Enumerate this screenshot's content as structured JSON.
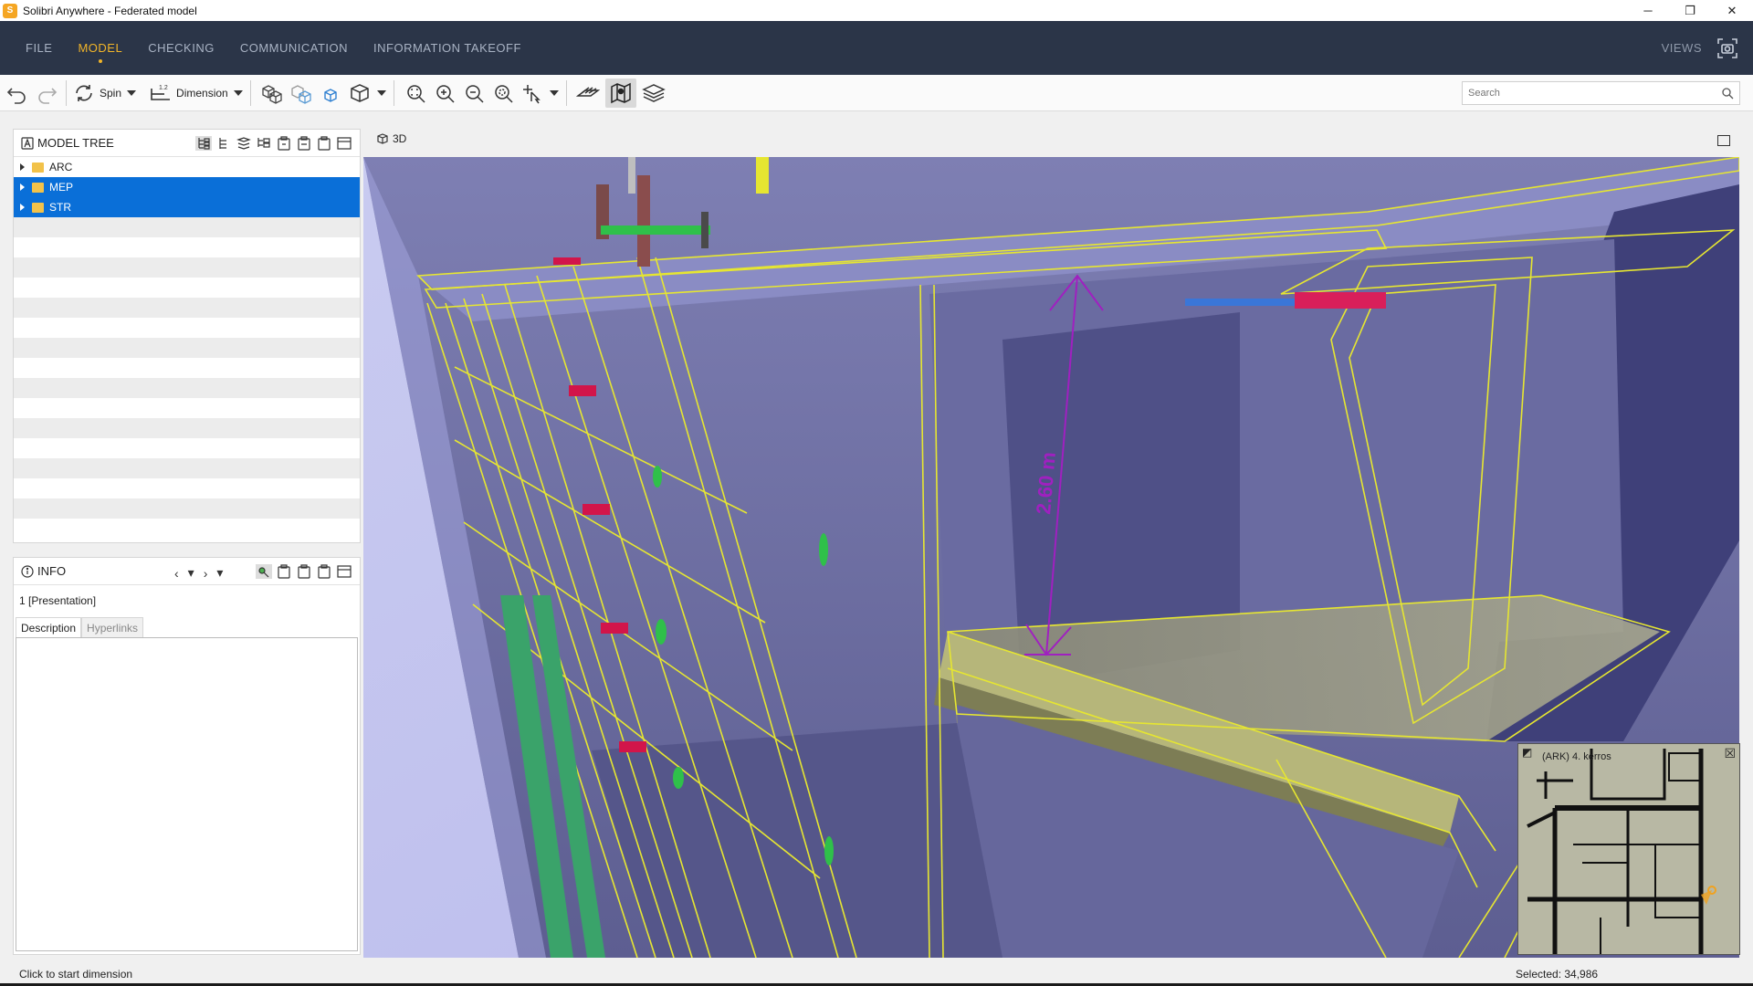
{
  "window": {
    "title": "Solibri Anywhere - Federated model",
    "app_icon_letter": "S",
    "controls": {
      "minimize": "─",
      "restore": "❐",
      "close": "✕"
    }
  },
  "menu": {
    "items": [
      {
        "label": "FILE",
        "active": false
      },
      {
        "label": "MODEL",
        "active": true
      },
      {
        "label": "CHECKING",
        "active": false
      },
      {
        "label": "COMMUNICATION",
        "active": false
      },
      {
        "label": "INFORMATION TAKEOFF",
        "active": false
      }
    ],
    "views_label": "VIEWS",
    "active_color": "#f0b429"
  },
  "toolbar": {
    "spin_label": "Spin",
    "dimension_label": "Dimension",
    "search_placeholder": "Search"
  },
  "model_tree": {
    "title": "MODEL TREE",
    "items": [
      {
        "label": "ARC",
        "selected": false
      },
      {
        "label": "MEP",
        "selected": true
      },
      {
        "label": "STR",
        "selected": true
      }
    ],
    "selection_color": "#0a6fd8"
  },
  "info": {
    "title": "INFO",
    "subtitle": "1 [Presentation]",
    "tabs": [
      {
        "label": "Description",
        "active": true
      },
      {
        "label": "Hyperlinks",
        "active": false
      }
    ]
  },
  "view": {
    "label": "3D",
    "dimension_text": "2.60 m",
    "minimap_title": "(ARK) 4. kerros"
  },
  "status": {
    "message": "Click to start dimension",
    "selected": "Selected: 34,986"
  }
}
